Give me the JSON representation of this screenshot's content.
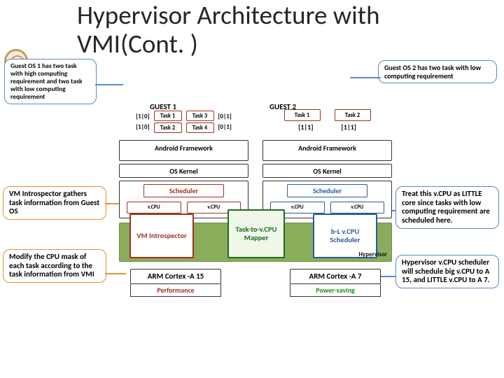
{
  "title_line1": "Hypervisor Architecture with",
  "title_line2": "VMI(Cont. )",
  "callouts": {
    "os1": "Guest OS 1 has two task with high computing requirement and two task with low computing requirement",
    "os2": "Guest OS 2 has two task with low computing requirement",
    "vmi": "VM Introspector gathers task information from Guest OS",
    "modify": "Modify the CPU mask of each task according to the task information from VMI",
    "little": "Treat this v.CPU as LITTLE core since tasks with low computing requirement are scheduled here.",
    "sched": "Hypervisor v.CPU scheduler will schedule big v.CPU to A 15, and LITTLE v.CPU to A 7."
  },
  "guest1": {
    "label": "GUEST 1",
    "masks_left": [
      "[1|0]",
      "[1|0]"
    ],
    "tasks_left": [
      "Task 1",
      "Task 2"
    ],
    "tasks_right": [
      "Task 3",
      "Task 4"
    ],
    "masks_right": [
      "[0|1]",
      "[0|1]"
    ],
    "android": "Android Framework",
    "kernel": "OS Kernel",
    "scheduler": "Scheduler",
    "vcpu": "v.CPU"
  },
  "guest2": {
    "label": "GUEST 2",
    "tasks": [
      "Task 1",
      "Task 2"
    ],
    "masks": [
      "[1|1]",
      "[1|1]"
    ],
    "android": "Android Framework",
    "kernel": "OS Kernel",
    "scheduler": "Scheduler",
    "vcpu": "v.CPU"
  },
  "hypervisor": {
    "vm_introspector": "VM Introspector",
    "mapper": "Task-to-v.CPU Mapper",
    "bl_scheduler": "b-L v.CPU Scheduler",
    "label": "Hypervisor"
  },
  "cores": {
    "a15": "ARM Cortex -A 15",
    "a15_sub": "Performance",
    "a7": "ARM Cortex -A 7",
    "a7_sub": "Power-saving"
  },
  "chart_data": {
    "type": "diagram",
    "description": "Hypervisor architecture with VM Introspection (VMI) on ARM big.LITTLE",
    "layers_top_to_bottom": [
      "Guest OS tasks with CPU affinity masks",
      "Android Framework",
      "OS Kernel",
      "Scheduler with vCPUs",
      "Hypervisor (VM Introspector, Task-to-vCPU Mapper, b-L vCPU Scheduler)",
      "Physical cores (ARM Cortex-A15 performance, ARM Cortex-A7 power-saving)"
    ],
    "guest1_tasks": [
      {
        "name": "Task 1",
        "mask": "[1|0]",
        "requirement": "high"
      },
      {
        "name": "Task 2",
        "mask": "[1|0]",
        "requirement": "high"
      },
      {
        "name": "Task 3",
        "mask": "[0|1]",
        "requirement": "low"
      },
      {
        "name": "Task 4",
        "mask": "[0|1]",
        "requirement": "low"
      }
    ],
    "guest2_tasks": [
      {
        "name": "Task 1",
        "mask": "[1|1]",
        "requirement": "low"
      },
      {
        "name": "Task 2",
        "mask": "[1|1]",
        "requirement": "low"
      }
    ],
    "vcpus_per_guest": 2,
    "physical_cores": [
      {
        "name": "ARM Cortex-A15",
        "role": "Performance",
        "type": "big"
      },
      {
        "name": "ARM Cortex-A7",
        "role": "Power-saving",
        "type": "LITTLE"
      }
    ],
    "mapping_rule": "Hypervisor vCPU scheduler maps big vCPU → A15, LITTLE vCPU → A7"
  }
}
